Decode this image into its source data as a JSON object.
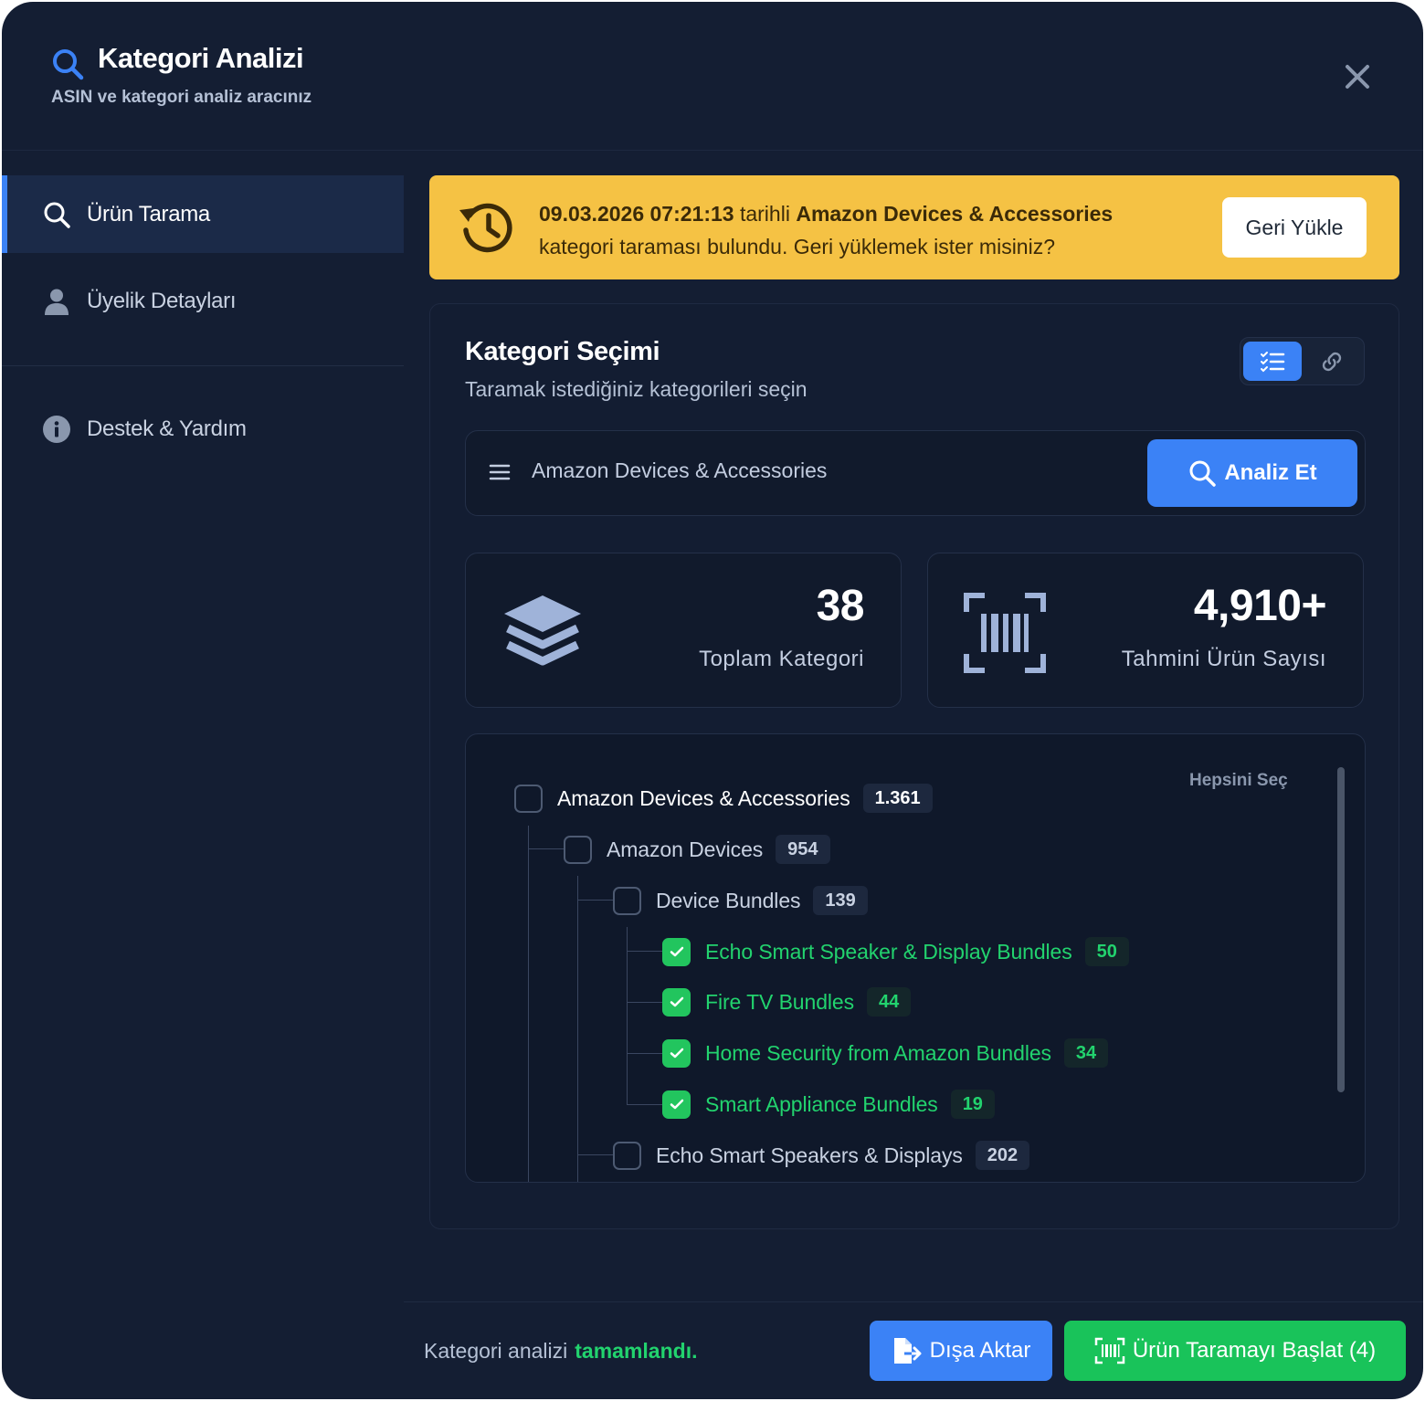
{
  "header": {
    "title": "Kategori Analizi",
    "subtitle": "ASIN ve kategori analiz aracınız"
  },
  "sidebar": {
    "items": [
      {
        "label": "Ürün Tarama",
        "icon": "search-icon",
        "active": true
      },
      {
        "label": "Üyelik Detayları",
        "icon": "user-icon",
        "active": false
      },
      {
        "label": "Destek & Yardım",
        "icon": "info-icon",
        "active": false
      }
    ]
  },
  "banner": {
    "date": "09.03.2026 07:21:13",
    "mid": " tarihli ",
    "category": "Amazon Devices & Accessories",
    "line2": "kategori taraması bulundu. Geri yüklemek ister misiniz?",
    "button": "Geri Yükle"
  },
  "selection": {
    "title": "Kategori Seçimi",
    "subtitle": "Taramak istediğiniz kategorileri seçin",
    "view_mode": "list",
    "search_value": "Amazon Devices & Accessories",
    "analyze_label": "Analiz Et"
  },
  "stats": {
    "categories": {
      "value": "38",
      "label": "Toplam Kategori",
      "icon": "layers-icon"
    },
    "products": {
      "value": "4,910+",
      "label": "Tahmini Ürün Sayısı",
      "icon": "barcode-icon"
    }
  },
  "tree": {
    "select_all": "Hepsini Seç",
    "rows": [
      {
        "label": "Amazon Devices & Accessories",
        "count": "1.361",
        "level": 0,
        "checked": false
      },
      {
        "label": "Amazon Devices",
        "count": "954",
        "level": 1,
        "checked": false
      },
      {
        "label": "Device Bundles",
        "count": "139",
        "level": 2,
        "checked": false
      },
      {
        "label": "Echo Smart Speaker & Display Bundles",
        "count": "50",
        "level": 3,
        "checked": true
      },
      {
        "label": "Fire TV Bundles",
        "count": "44",
        "level": 3,
        "checked": true
      },
      {
        "label": "Home Security from Amazon Bundles",
        "count": "34",
        "level": 3,
        "checked": true
      },
      {
        "label": "Smart Appliance Bundles",
        "count": "19",
        "level": 3,
        "checked": true
      },
      {
        "label": "Echo Smart Speakers & Displays",
        "count": "202",
        "level": 2,
        "checked": false
      }
    ]
  },
  "footer": {
    "status_prefix": "Kategori analizi",
    "status_value": "tamamlandı.",
    "export_label": "Dışa Aktar",
    "scan_label": "Ürün Taramayı Başlat (4)"
  },
  "colors": {
    "accent": "#3b82f6",
    "success": "#22c55e",
    "warning": "#f5c244",
    "background": "#141e33"
  }
}
